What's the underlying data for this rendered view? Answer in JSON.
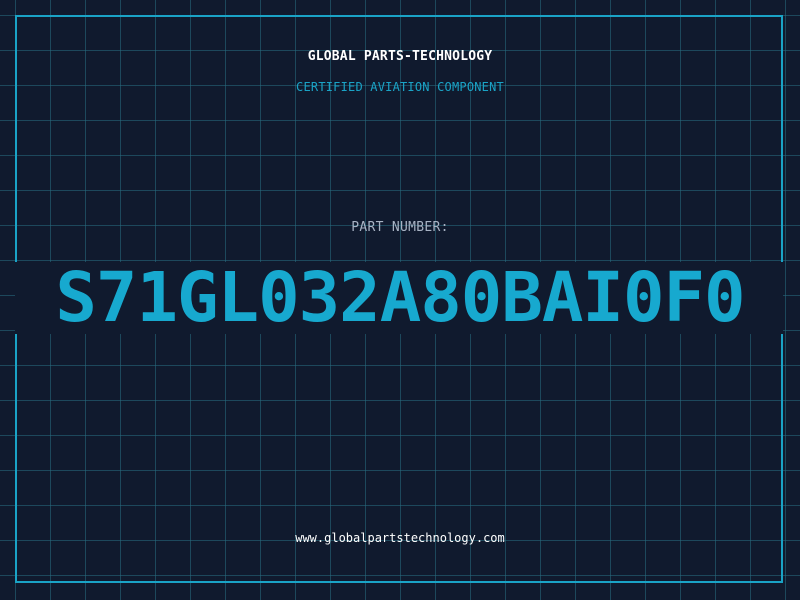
{
  "header": {
    "company": "GLOBAL PARTS-TECHNOLOGY",
    "subtitle": "CERTIFIED AVIATION COMPONENT"
  },
  "part": {
    "label": "PART NUMBER:",
    "number": "S71GL032A80BAI0F0"
  },
  "footer": {
    "url": "www.globalpartstechnology.com"
  },
  "colors": {
    "background": "#101a2e",
    "grid": "#286e82",
    "accent": "#1aa3c6",
    "text": "#ffffff"
  }
}
